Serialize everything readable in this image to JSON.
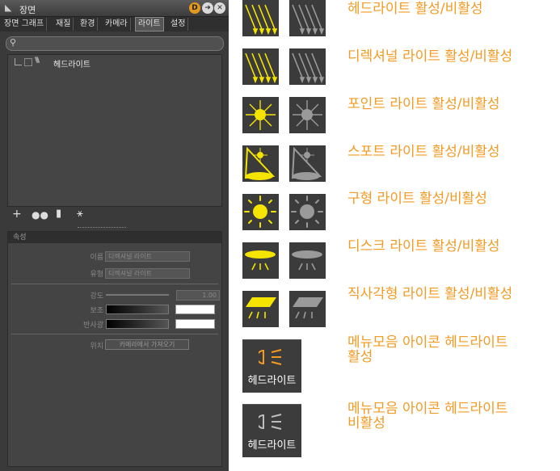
{
  "panel": {
    "title": "장면",
    "d_badge": "D",
    "tabs": [
      "장면 그래프",
      "재질",
      "환경",
      "카메라",
      "라이트",
      "설정"
    ],
    "active_tab": "라이트",
    "tree_item": "헤드라이트",
    "props": {
      "section": "속성",
      "name_label": "이름",
      "name_value": "디렉셔널 라이트",
      "type_label": "유형",
      "type_value": "디렉셔널 라이트",
      "intensity_label": "강도",
      "intensity_value": "1.00",
      "ambient_label": "보조",
      "diffuse_label": "반사광",
      "position_label": "위치",
      "position_button": "카메라에서 가져오기"
    }
  },
  "legend": {
    "headlight": "헤드라이트 활성/비활성",
    "directional": "디렉셔널 라이트 활성/비활성",
    "point": "포인트 라이트 활성/비활성",
    "spot": "스포트 라이트 활성/비활성",
    "sphere": "구형 라이트 활성/비활성",
    "disk": "디스크 라이트 활성/비활성",
    "rect": "직사각형 라이트 활성/비활성",
    "menu_on_line1": "메뉴모음 아이콘 헤드라이트",
    "menu_on_line2": "활성",
    "menu_off_line1": "메뉴모음 아이콘 헤드라이트 ",
    "menu_off_line2": "비활성",
    "menu_icon_text": "헤드라이트"
  },
  "colors": {
    "accent": "#f39a22",
    "active_icon": "#f5e400",
    "inactive_icon": "#9a9a9a"
  }
}
